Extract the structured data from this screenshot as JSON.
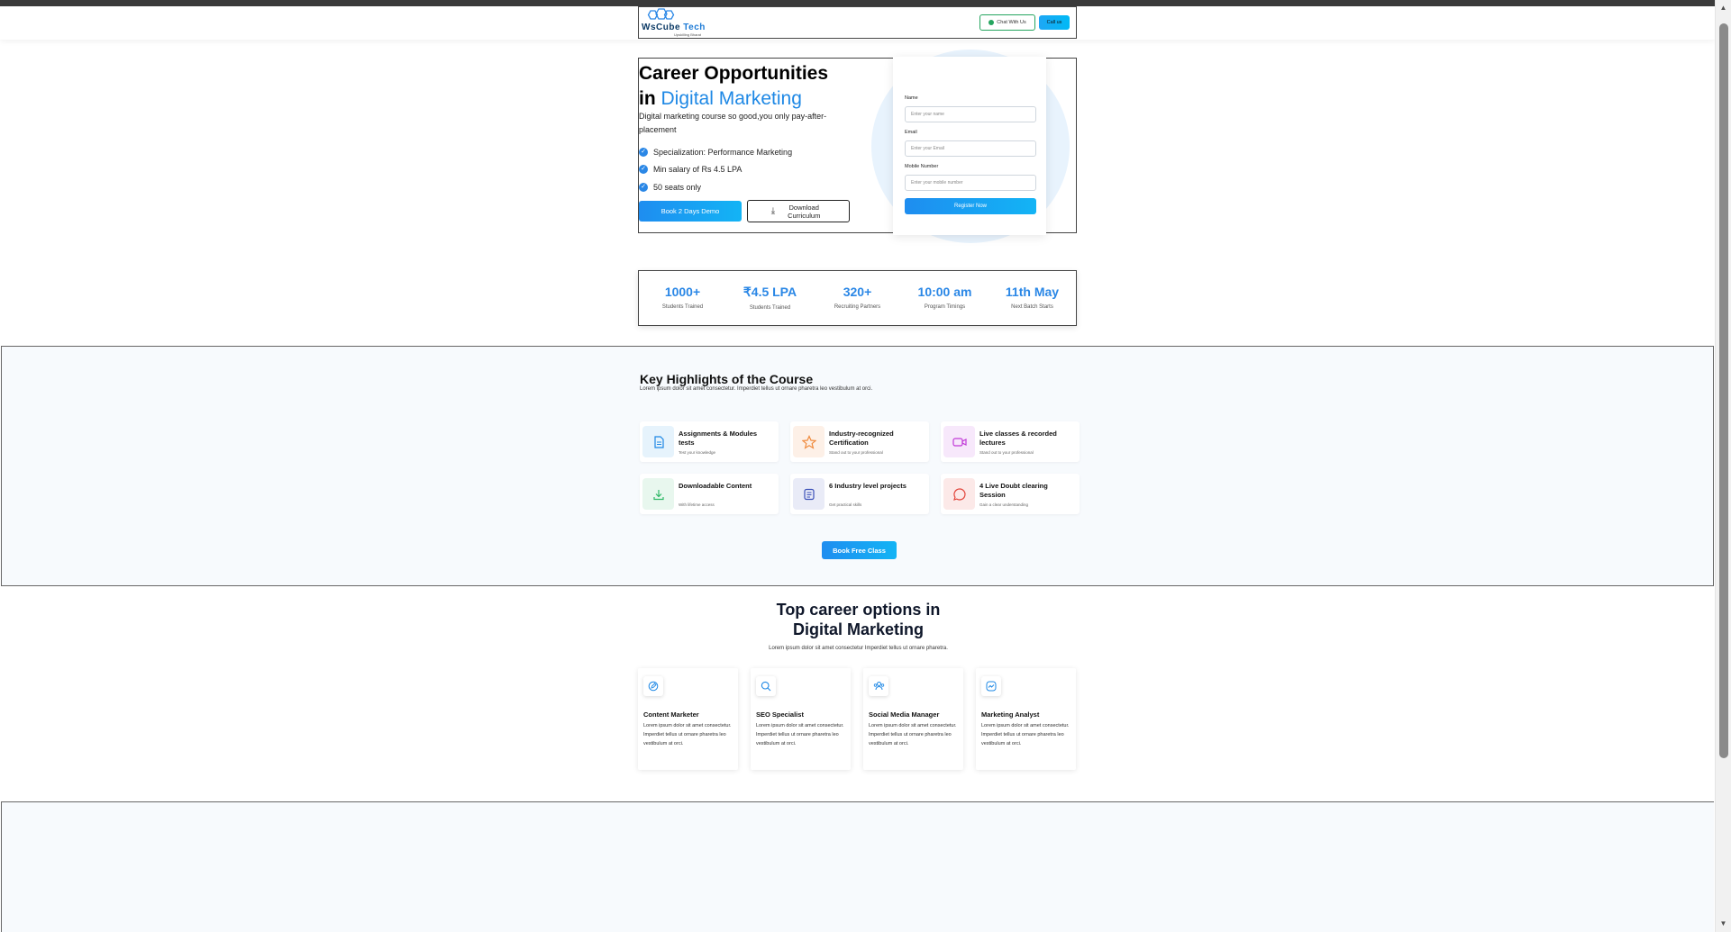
{
  "header": {
    "logo_main": "WsCube",
    "logo_accent": "Tech",
    "logo_tagline": "Upskilling Bharat",
    "chat_label": "Chat With Us",
    "call_label": "Call us"
  },
  "hero": {
    "title_line1": "Career Opportunities",
    "title_prefix": "in",
    "title_highlight": "Digital Marketing",
    "subtitle": "Digital marketing course so good,you only pay-after-placement",
    "checklist": [
      "Specialization: Performance Marketing",
      "Min salary of Rs 4.5 LPA",
      "50 seats only"
    ],
    "demo_button": "Book 2 Days Demo",
    "download_button": "Download Curriculum"
  },
  "form": {
    "name_label": "Name",
    "name_placeholder": "Enter your name",
    "email_label": "Email",
    "email_placeholder": "Enter your Email",
    "mobile_label": "Mobile Number",
    "mobile_placeholder": "Enter your mobile number",
    "register_button": "Register Now"
  },
  "stats": [
    {
      "value": "1000+",
      "label": "Students Trained"
    },
    {
      "value": "₹4.5 LPA",
      "label": "Students Trained"
    },
    {
      "value": "320+",
      "label": "Recruiting Partners"
    },
    {
      "value": "10:00 am",
      "label": "Program Timings"
    },
    {
      "value": "11th May",
      "label": "Next Batch Starts"
    }
  ],
  "highlights": {
    "title": "Key Highlights of the Course",
    "subtitle": "Lorem ipsum dolor sit amet consectetur. Imperdiet tellus ut ornare pharetra leo vestibulum at orci.",
    "items": [
      {
        "name": "Assignments & Modules tests",
        "desc": "Test your knowledge",
        "icon": "document-icon",
        "color": "#1e88e5",
        "bg": "#e6f3fc"
      },
      {
        "name": "Industry-recognized Certification",
        "desc": "Stand out to your professional",
        "icon": "star-icon",
        "color": "#f08a3c",
        "bg": "#fdf0e7"
      },
      {
        "name": "Live classes & recorded lectures",
        "desc": "Stand out to your professional",
        "icon": "video-icon",
        "color": "#c13ad8",
        "bg": "#f7e8fb"
      },
      {
        "name": "Downloadable Content",
        "desc": "With lifetime access",
        "icon": "download-icon",
        "color": "#2fb866",
        "bg": "#e8f7ee"
      },
      {
        "name": "6 Industry level projects",
        "desc": "Get practical skills",
        "icon": "list-icon",
        "color": "#3a4fb8",
        "bg": "#e9ebf7"
      },
      {
        "name": "4 Live Doubt clearing Session",
        "desc": "Gain a clear understanding",
        "icon": "chat-bubble-icon",
        "color": "#e2443a",
        "bg": "#fce9e8"
      }
    ],
    "cta": "Book Free Class"
  },
  "careers": {
    "title_line1": "Top career options in",
    "title_line2": "Digital Marketing",
    "subtitle": "Lorem ipsum dolor sit amet consectetur Imperdiet tellus ut ornare pharetra.",
    "items": [
      {
        "name": "Content Marketer",
        "desc": "Lorem ipsum dolor sit amet consectetur. Imperdiet tellus ut ornare pharetra leo vestibulum at orci.",
        "icon": "edit-icon"
      },
      {
        "name": "SEO Specialist",
        "desc": "Lorem ipsum dolor sit amet consectetur. Imperdiet tellus ut ornare pharetra leo vestibulum at orci.",
        "icon": "search-icon"
      },
      {
        "name": "Social Media Manager",
        "desc": "Lorem ipsum dolor sit amet consectetur. Imperdiet tellus ut ornare pharetra leo vestibulum at orci.",
        "icon": "users-icon"
      },
      {
        "name": "Marketing Analyst",
        "desc": "Lorem ipsum dolor sit amet consectetur. Imperdiet tellus ut ornare pharetra leo vestibulum at orci.",
        "icon": "analytics-icon"
      }
    ]
  }
}
